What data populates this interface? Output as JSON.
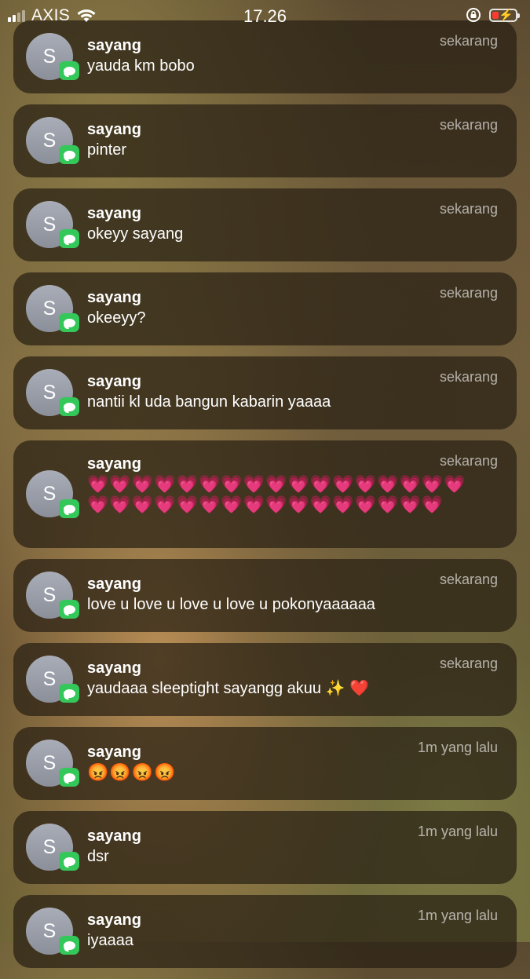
{
  "status_bar": {
    "carrier": "AXIS",
    "time": "17.26"
  },
  "notifications": [
    {
      "avatar": "S",
      "sender": "sayang",
      "time": "sekarang",
      "message": "yauda km bobo"
    },
    {
      "avatar": "S",
      "sender": "sayang",
      "time": "sekarang",
      "message": "pinter"
    },
    {
      "avatar": "S",
      "sender": "sayang",
      "time": "sekarang",
      "message": "okeyy sayang"
    },
    {
      "avatar": "S",
      "sender": "sayang",
      "time": "sekarang",
      "message": "okeeyy?"
    },
    {
      "avatar": "S",
      "sender": "sayang",
      "time": "sekarang",
      "message": "nantii kl uda bangun kabarin yaaaa"
    },
    {
      "avatar": "S",
      "sender": "sayang",
      "time": "sekarang",
      "message": "💗💗💗💗💗💗💗💗💗💗💗💗💗💗💗💗💗💗💗💗💗💗💗💗💗💗💗💗💗💗💗💗💗"
    },
    {
      "avatar": "S",
      "sender": "sayang",
      "time": "sekarang",
      "message": "love u love u love u love u pokonyaaaaaa"
    },
    {
      "avatar": "S",
      "sender": "sayang",
      "time": "sekarang",
      "message": "yaudaaa sleeptight sayangg akuu ✨ ❤️"
    },
    {
      "avatar": "S",
      "sender": "sayang",
      "time": "1m yang lalu",
      "message": "😡😡😡😡"
    },
    {
      "avatar": "S",
      "sender": "sayang",
      "time": "1m yang lalu",
      "message": "dsr"
    },
    {
      "avatar": "S",
      "sender": "sayang",
      "time": "1m yang lalu",
      "message": "iyaaaa"
    }
  ],
  "icons": {
    "app_badge": "messages-icon",
    "status": [
      "signal-icon",
      "wifi-icon",
      "rotation-lock-icon",
      "battery-charging-icon"
    ]
  },
  "colors": {
    "badge_green": "#34c759",
    "battery_low": "#ff3b30"
  }
}
